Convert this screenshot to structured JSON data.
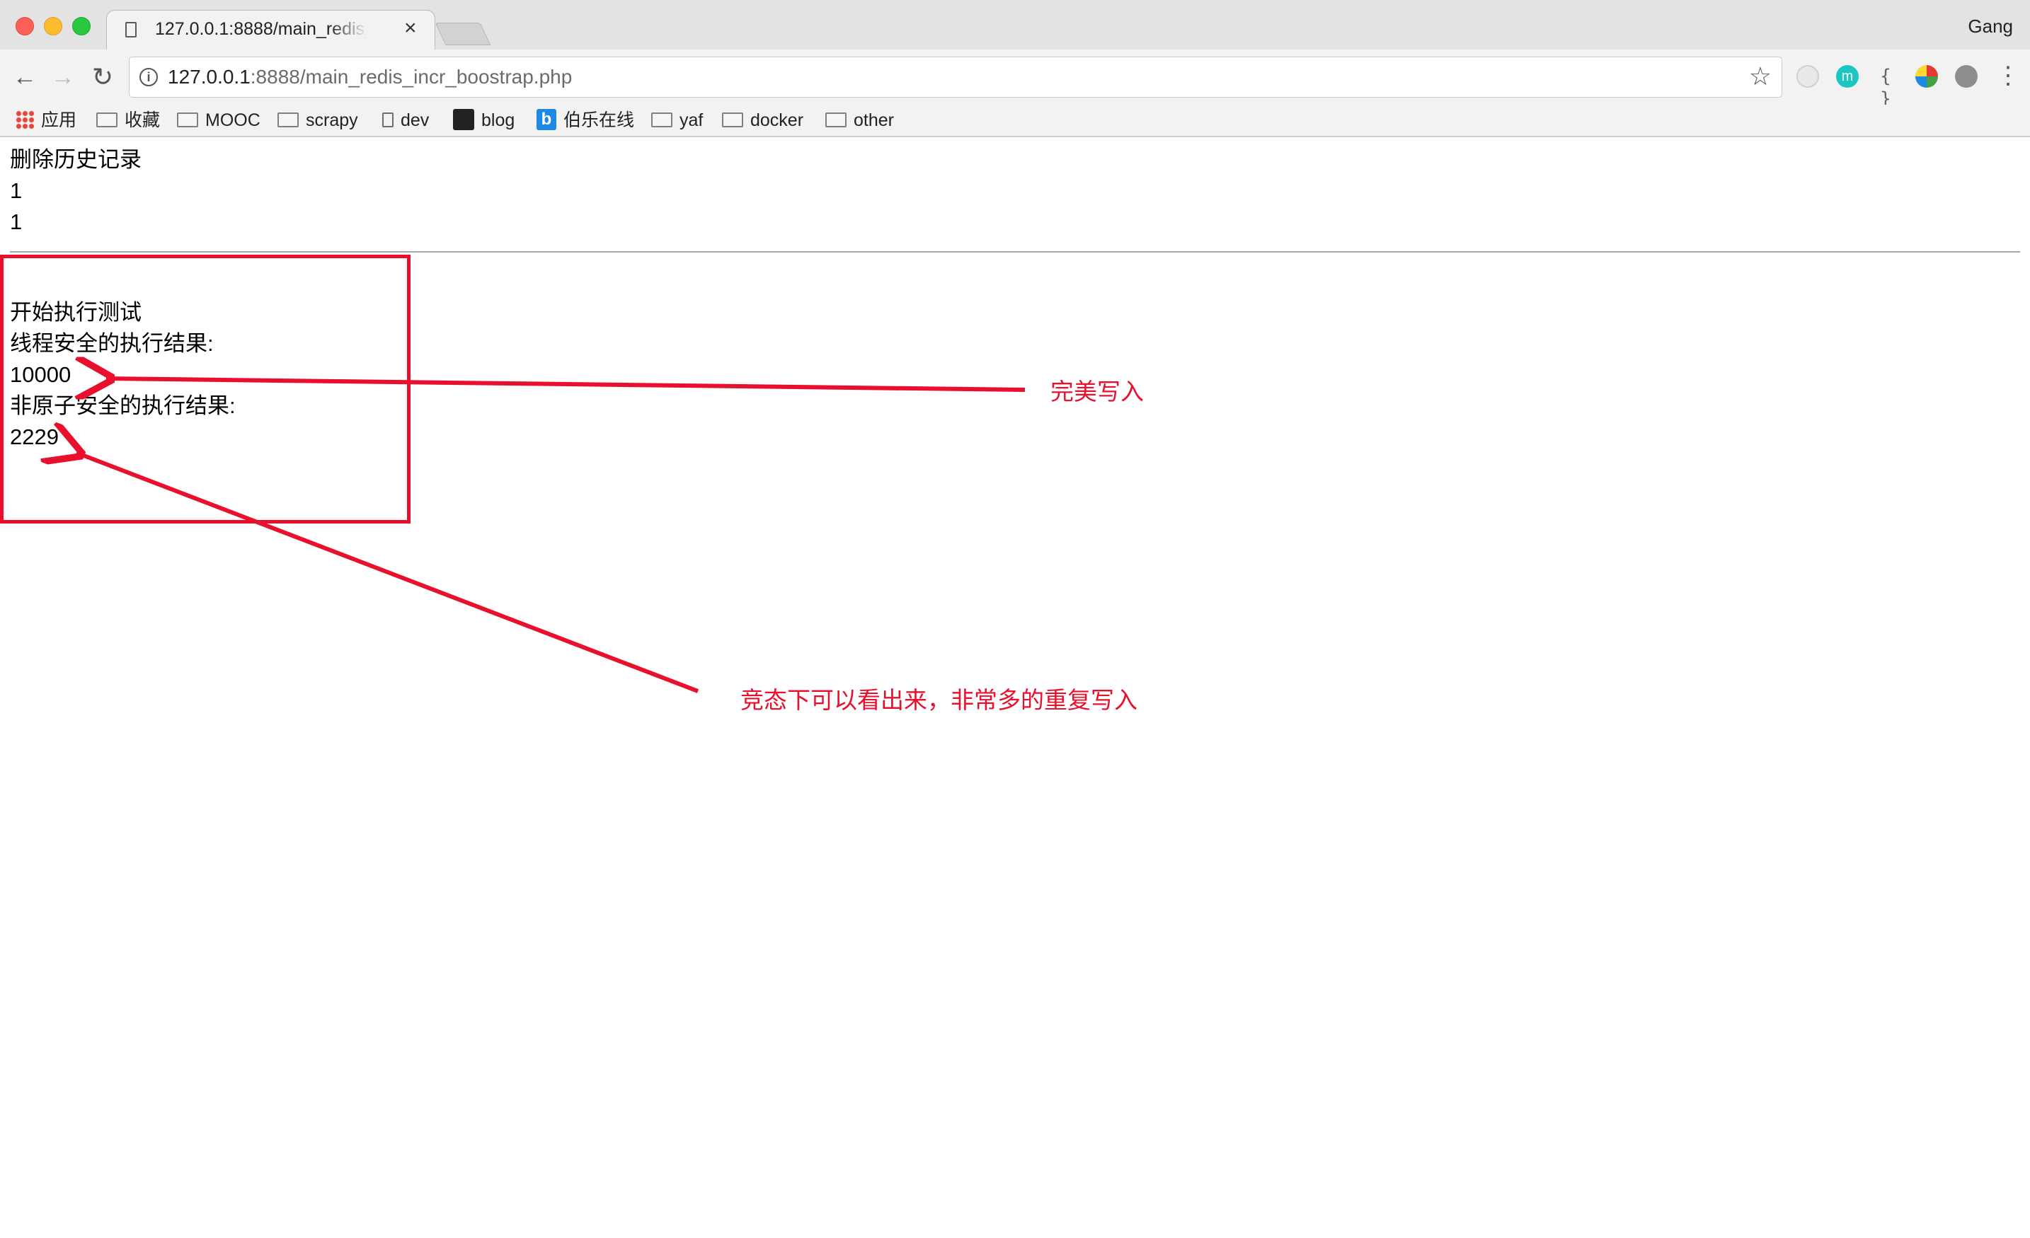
{
  "browser": {
    "tab_title": "127.0.0.1:8888/main_redis_incr_boostrap.php",
    "tab_close": "×",
    "profile_name": "Gang",
    "url_host": "127.0.0.1",
    "url_rest": ":8888/main_redis_incr_boostrap.php",
    "nav_back": "←",
    "nav_forward": "→",
    "nav_reload": "↻",
    "star": "☆",
    "menu": "⋮",
    "ext_braces": "{ }",
    "ext_m": "m"
  },
  "bookmarks": [
    {
      "label": "应用",
      "icon": "apps-icon"
    },
    {
      "label": "收藏",
      "icon": "folder-icon"
    },
    {
      "label": "MOOC",
      "icon": "folder-icon"
    },
    {
      "label": "scrapy",
      "icon": "folder-icon"
    },
    {
      "label": "dev",
      "icon": "page-icon"
    },
    {
      "label": "blog",
      "icon": "pirate-icon"
    },
    {
      "label": "伯乐在线",
      "icon": "b-logo-icon"
    },
    {
      "label": "yaf",
      "icon": "folder-icon"
    },
    {
      "label": "docker",
      "icon": "folder-icon"
    },
    {
      "label": "other",
      "icon": "folder-icon"
    }
  ],
  "page": {
    "lines_top": [
      "删除历史记录",
      "1",
      "1"
    ],
    "lines_bottom": [
      "开始执行测试",
      "线程安全的执行结果:",
      "10000",
      "非原子安全的执行结果:",
      "2229"
    ]
  },
  "annotations": {
    "note_safe": "完美写入",
    "note_race": "竞态下可以看出来，非常多的重复写入",
    "color": "#e8102d"
  }
}
